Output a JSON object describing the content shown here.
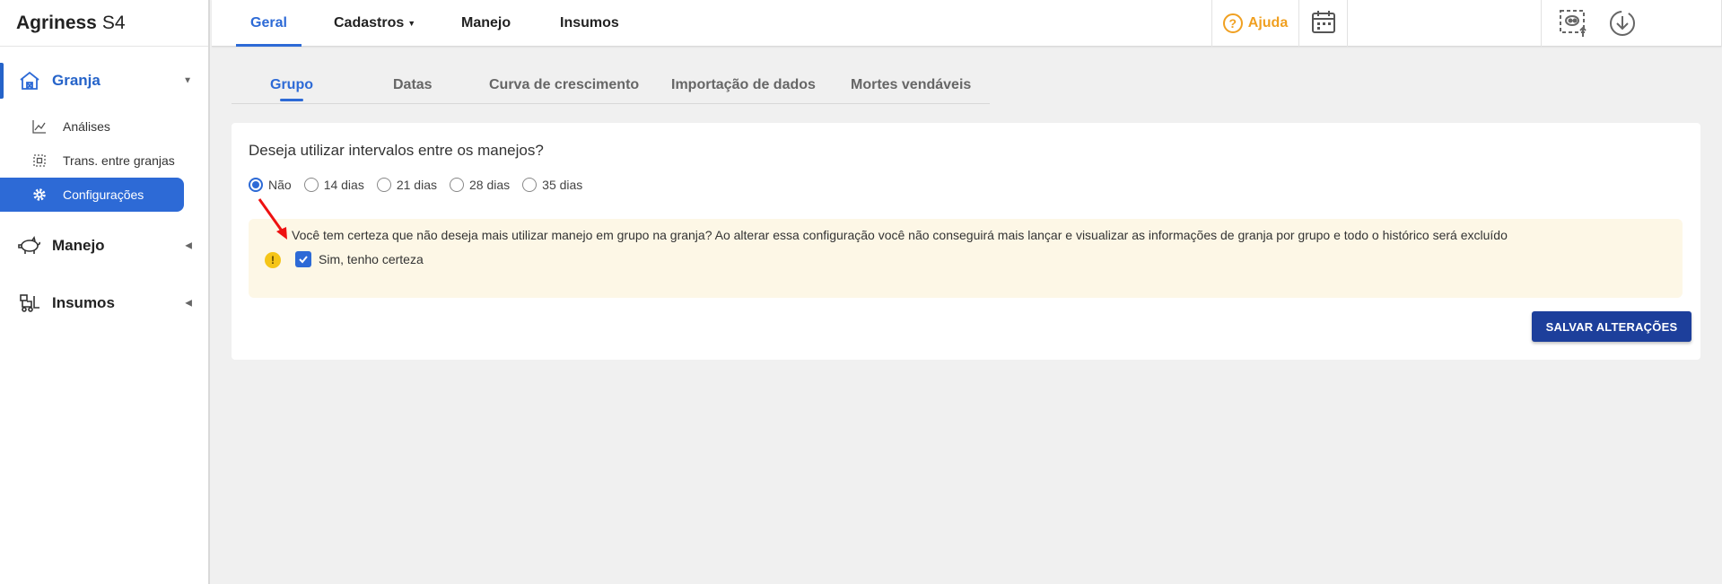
{
  "app": {
    "brand_bold": "Agriness",
    "brand_suffix": "S4"
  },
  "sidebar": {
    "groups": [
      {
        "label": "Granja",
        "icon": "farm-house-icon",
        "active": true
      },
      {
        "label": "Manejo",
        "icon": "pig-icon"
      },
      {
        "label": "Insumos",
        "icon": "forklift-icon"
      }
    ],
    "sub_items": [
      {
        "label": "Análises",
        "icon": "line-chart-icon"
      },
      {
        "label": "Trans. entre granjas",
        "icon": "transfer-icon"
      },
      {
        "label": "Configurações",
        "icon": "gear-icon",
        "active": true
      }
    ]
  },
  "topbar": {
    "tabs": [
      {
        "label": "Geral",
        "active": true
      },
      {
        "label": "Cadastros",
        "dropdown": true
      },
      {
        "label": "Manejo"
      },
      {
        "label": "Insumos"
      }
    ],
    "help_label": "Ajuda",
    "accent": "#2d6ad6",
    "help_color": "#f0a021"
  },
  "subtabs": [
    {
      "label": "Grupo",
      "active": true
    },
    {
      "label": "Datas"
    },
    {
      "label": "Curva de crescimento"
    },
    {
      "label": "Importação de dados"
    },
    {
      "label": "Mortes vendáveis"
    }
  ],
  "form": {
    "question": "Deseja utilizar intervalos entre os manejos?",
    "options": [
      {
        "label": "Não",
        "checked": true
      },
      {
        "label": "14 dias"
      },
      {
        "label": "21 dias"
      },
      {
        "label": "28 dias"
      },
      {
        "label": "35 dias"
      }
    ],
    "warning_text": "Você tem certeza que não deseja mais utilizar manejo em grupo na granja? Ao alterar essa configuração você não conseguirá mais lançar e visualizar as informações de granja por grupo e todo o histórico será excluído",
    "confirm_label": "Sim, tenho certeza",
    "confirm_checked": true,
    "save_label": "SALVAR ALTERAÇÕES"
  }
}
